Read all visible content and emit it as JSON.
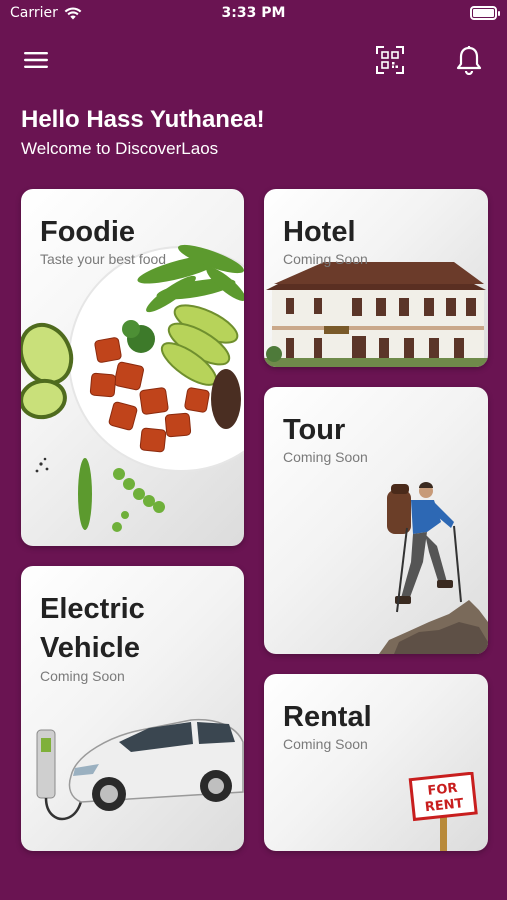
{
  "status_bar": {
    "carrier": "Carrier",
    "time": "3:33 PM"
  },
  "header": {
    "menu_icon": "hamburger-menu-icon",
    "qr_icon": "qr-scan-icon",
    "bell_icon": "bell-icon"
  },
  "greeting": {
    "title": "Hello Hass Yuthanea!",
    "subtitle": "Welcome to DiscoverLaos"
  },
  "cards": {
    "foodie": {
      "title": "Foodie",
      "subtitle": "Taste your best food"
    },
    "hotel": {
      "title": "Hotel",
      "subtitle": "Coming Soon"
    },
    "tour": {
      "title": "Tour",
      "subtitle": "Coming Soon"
    },
    "ev": {
      "title_line1": "Electric",
      "title_line2": "Vehicle",
      "subtitle": "Coming Soon"
    },
    "rental": {
      "title": "Rental",
      "subtitle": "Coming Soon",
      "sign_line1": "FOR",
      "sign_line2": "RENT"
    }
  },
  "colors": {
    "background": "#6a1452",
    "card_bg": "#f3f3f3",
    "title_text": "#222222",
    "subtitle_text": "#7a7a7a"
  }
}
